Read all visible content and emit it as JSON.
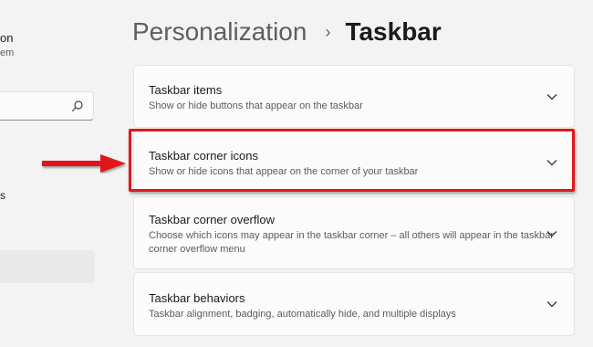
{
  "sidebar": {
    "profile_name": "on",
    "profile_sub": "em",
    "nav_fragment": "s"
  },
  "breadcrumb": {
    "parent": "Personalization",
    "separator": "›",
    "current": "Taskbar"
  },
  "cards": [
    {
      "title": "Taskbar items",
      "description": "Show or hide buttons that appear on the taskbar"
    },
    {
      "title": "Taskbar corner icons",
      "description": "Show or hide icons that appear on the corner of your taskbar"
    },
    {
      "title": "Taskbar corner overflow",
      "description": "Choose which icons may appear in the taskbar corner – all others will appear in the taskbar corner overflow menu"
    },
    {
      "title": "Taskbar behaviors",
      "description": "Taskbar alignment, badging, automatically hide, and multiple displays"
    }
  ],
  "colors": {
    "highlight": "#e0181b",
    "background": "#f3f3f3",
    "card": "#fbfbfb"
  },
  "icons": {
    "search": "search-icon",
    "chevron": "chevron-down-icon",
    "arrow": "red-arrow-icon"
  }
}
